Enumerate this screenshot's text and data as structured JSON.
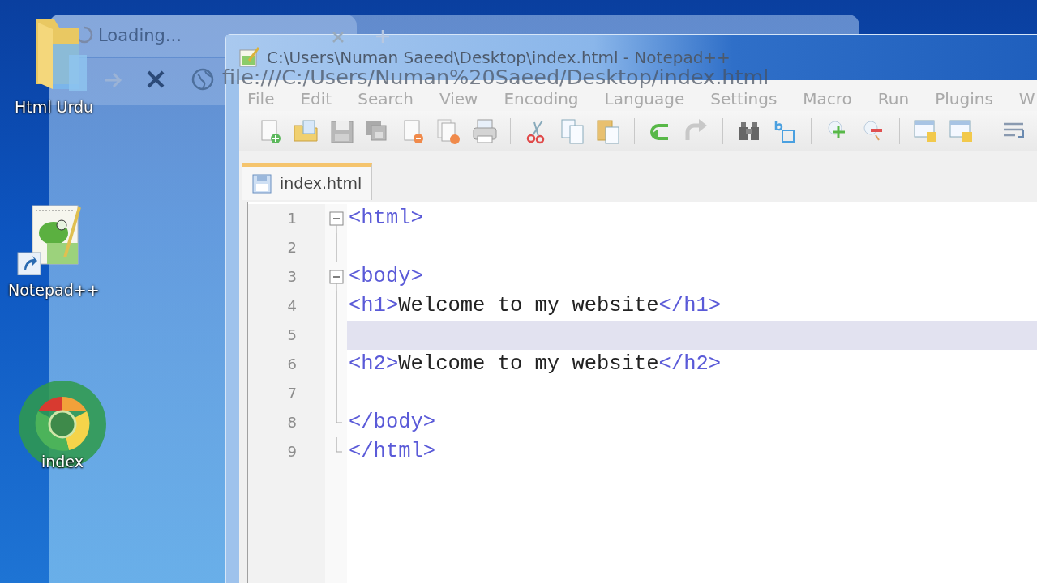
{
  "desktop_icons": [
    {
      "kind": "folder",
      "label": "Html Urdu"
    },
    {
      "kind": "notepad",
      "label": "Notepad++"
    },
    {
      "kind": "chrome",
      "label": "index"
    }
  ],
  "browser": {
    "tab_title": "Loading...",
    "address": "file:///C:/Users/Numan%20Saeed/Desktop/index.html"
  },
  "editor_window": {
    "title": "C:\\Users\\Numan Saeed\\Desktop\\index.html - Notepad++",
    "menu": [
      "File",
      "Edit",
      "Search",
      "View",
      "Encoding",
      "Language",
      "Settings",
      "Macro",
      "Run",
      "Plugins",
      "W"
    ],
    "tabs": [
      {
        "label": "index.html",
        "selected": true
      }
    ],
    "lines": [
      {
        "number": "1",
        "text": "<html>",
        "kind": "start",
        "current": false
      },
      {
        "number": "2",
        "kind": "middle",
        "current": false
      },
      {
        "number": "3",
        "text": "<body>",
        "kind": "start",
        "current": false
      },
      {
        "number": "4",
        "text": "<h1>Welcome to my website</h1>",
        "kind": "middle",
        "current": false
      },
      {
        "number": "5",
        "kind": "middle",
        "current": true
      },
      {
        "number": "6",
        "text": "<h2>Welcome to my website</h2>",
        "kind": "middle",
        "current": false
      },
      {
        "number": "7",
        "kind": "middle",
        "current": false
      },
      {
        "number": "8",
        "text": "</body>",
        "kind": "end",
        "current": false
      },
      {
        "number": "9",
        "text": "</html>",
        "kind": "end",
        "current": false
      }
    ]
  }
}
